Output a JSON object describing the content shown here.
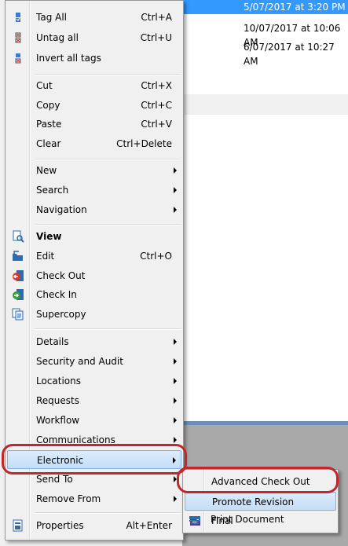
{
  "background": {
    "dates": [
      "5/07/2017 at 3:20 PM",
      "10/07/2017 at 10:06 AM",
      "6/07/2017 at 10:27 AM"
    ]
  },
  "menu": {
    "items": [
      {
        "label": "Tag All",
        "shortcut": "Ctrl+A",
        "icon": "tag-icon"
      },
      {
        "label": "Untag all",
        "shortcut": "Ctrl+U",
        "icon": "untag-icon"
      },
      {
        "label": "Invert all tags",
        "shortcut": "",
        "icon": "invert-tags-icon"
      },
      {
        "label": "Cut",
        "shortcut": "Ctrl+X"
      },
      {
        "label": "Copy",
        "shortcut": "Ctrl+C"
      },
      {
        "label": "Paste",
        "shortcut": "Ctrl+V"
      },
      {
        "label": "Clear",
        "shortcut": "Ctrl+Delete"
      },
      {
        "label": "New"
      },
      {
        "label": "Search"
      },
      {
        "label": "Navigation"
      },
      {
        "label": "View",
        "icon": "view-icon"
      },
      {
        "label": "Edit",
        "shortcut": "Ctrl+O",
        "icon": "edit-icon"
      },
      {
        "label": "Check Out",
        "icon": "check-out-icon"
      },
      {
        "label": "Check In",
        "icon": "check-in-icon"
      },
      {
        "label": "Supercopy",
        "icon": "supercopy-icon"
      },
      {
        "label": "Details"
      },
      {
        "label": "Security and Audit"
      },
      {
        "label": "Locations"
      },
      {
        "label": "Requests"
      },
      {
        "label": "Workflow"
      },
      {
        "label": "Communications"
      },
      {
        "label": "Electronic"
      },
      {
        "label": "Send To"
      },
      {
        "label": "Remove From"
      },
      {
        "label": "Properties",
        "shortcut": "Alt+Enter",
        "icon": "properties-icon"
      }
    ]
  },
  "submenu": {
    "items": [
      {
        "label": "Advanced Check Out"
      },
      {
        "label": "Promote Revision"
      },
      {
        "label": "Final",
        "icon": "final-icon"
      },
      {
        "label": "Print Document",
        "icon": "print-document-icon"
      }
    ]
  },
  "colors": {
    "highlight_ring": "#c0282d",
    "selection": "#3399ff",
    "hover": "#cce4f7"
  }
}
